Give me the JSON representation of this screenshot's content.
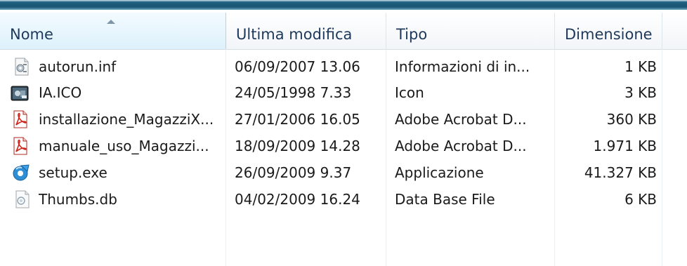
{
  "columns": {
    "name": "Nome",
    "modified": "Ultima modifica",
    "type": "Tipo",
    "size": "Dimensione"
  },
  "files": [
    {
      "name": "autorun.inf",
      "modified": "06/09/2007 13.06",
      "type": "Informazioni di in...",
      "size": "1 KB",
      "icon": "settings-file-icon"
    },
    {
      "name": "IA.ICO",
      "modified": "24/05/1998 7.33",
      "type": "Icon",
      "size": "3 KB",
      "icon": "ico-file-icon"
    },
    {
      "name": "installazione_MagazziX...",
      "modified": "27/01/2006 16.05",
      "type": "Adobe Acrobat D...",
      "size": "360 KB",
      "icon": "pdf-file-icon"
    },
    {
      "name": "manuale_uso_Magazzi...",
      "modified": "18/09/2009 14.28",
      "type": "Adobe Acrobat D...",
      "size": "1.971 KB",
      "icon": "pdf-file-icon"
    },
    {
      "name": "setup.exe",
      "modified": "26/09/2009 9.37",
      "type": "Applicazione",
      "size": "41.327 KB",
      "icon": "setup-exe-icon"
    },
    {
      "name": "Thumbs.db",
      "modified": "04/02/2009 16.24",
      "type": "Data Base File",
      "size": "6 KB",
      "icon": "db-file-icon"
    }
  ]
}
